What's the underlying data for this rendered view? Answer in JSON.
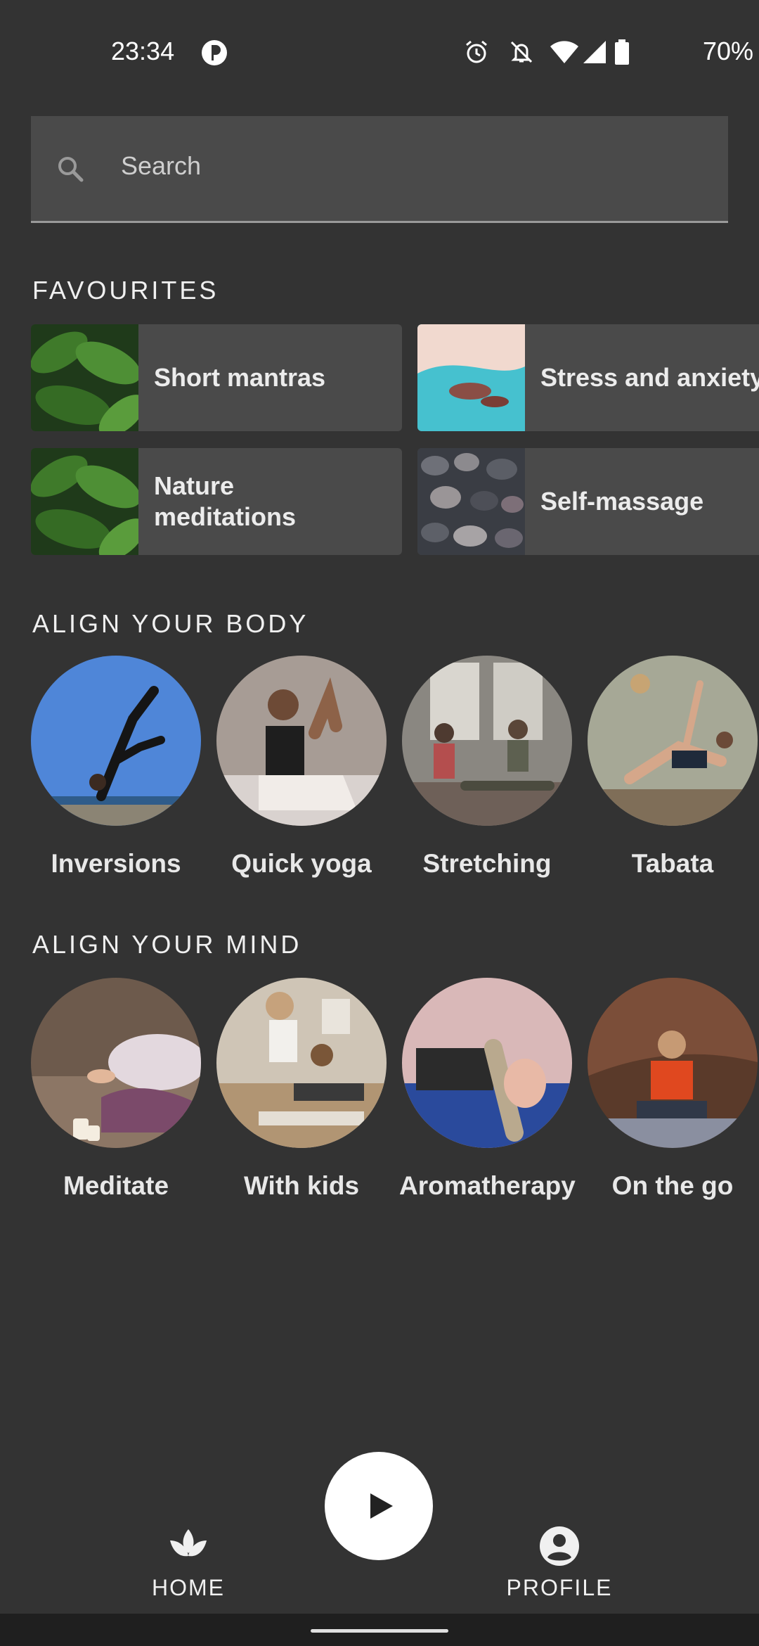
{
  "status_bar": {
    "time": "23:34",
    "battery": "70%",
    "icons": [
      "app-indicator-icon",
      "alarm-icon",
      "notifications-off-icon",
      "wifi-icon",
      "signal-icon",
      "battery-icon"
    ]
  },
  "search": {
    "placeholder": "Search"
  },
  "favourites": {
    "title": "FAVOURITES",
    "items": [
      {
        "label": "Short mantras"
      },
      {
        "label": "Stress and anxiety"
      },
      {
        "label": "Nature meditations"
      },
      {
        "label": "Self-massage"
      }
    ]
  },
  "body_section": {
    "title": "ALIGN YOUR BODY",
    "items": [
      {
        "label": "Inversions"
      },
      {
        "label": "Quick yoga"
      },
      {
        "label": "Stretching"
      },
      {
        "label": "Tabata"
      }
    ]
  },
  "mind_section": {
    "title": "ALIGN YOUR MIND",
    "items": [
      {
        "label": "Meditate"
      },
      {
        "label": "With kids"
      },
      {
        "label": "Aromatherapy"
      },
      {
        "label": "On the go"
      }
    ]
  },
  "bottom_nav": {
    "home": "HOME",
    "profile": "PROFILE"
  },
  "colors": {
    "background": "#333333",
    "card": "#4a4a4a",
    "text": "#e8e8e8",
    "play_button": "#ffffff"
  }
}
